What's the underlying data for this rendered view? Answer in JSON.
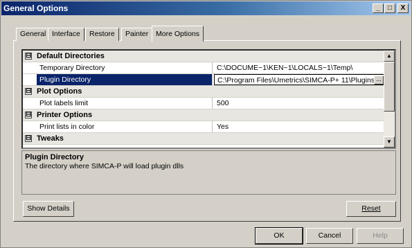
{
  "window": {
    "title": "General Options",
    "controls": {
      "minimize": "_",
      "maximize": "□",
      "close": "X"
    }
  },
  "tabs": [
    {
      "label": "General",
      "active": false
    },
    {
      "label": "Interface",
      "active": false
    },
    {
      "label": "Restore",
      "active": false
    },
    {
      "label": "Painter",
      "active": false
    },
    {
      "label": "More Options",
      "active": true
    }
  ],
  "grid": {
    "rows": [
      {
        "kind": "category",
        "label": "Default Directories",
        "expander": "⊟"
      },
      {
        "kind": "property",
        "name": "Temporary Directory",
        "value": "C:\\DOCUME~1\\KEN~1\\LOCALS~1\\Temp\\",
        "selected": false
      },
      {
        "kind": "property",
        "name": "Plugin Directory",
        "value": "C:\\Program Files\\Umetrics\\SIMCA-P+ 11\\Plugins",
        "selected": true,
        "ellipsis": "..."
      },
      {
        "kind": "category",
        "label": "Plot Options",
        "expander": "⊟"
      },
      {
        "kind": "property",
        "name": "Plot labels limit",
        "value": "500",
        "selected": false
      },
      {
        "kind": "category",
        "label": "Printer Options",
        "expander": "⊟"
      },
      {
        "kind": "property",
        "name": "Print lists in color",
        "value": "Yes",
        "selected": false
      },
      {
        "kind": "category",
        "label": "Tweaks",
        "expander": "⊟"
      }
    ],
    "scroll_up": "▲",
    "scroll_down": "▼"
  },
  "description": {
    "title": "Plugin Directory",
    "text": "The directory where SIMCA-P will load plugin dlls"
  },
  "buttons": {
    "show_details": "Show Details",
    "reset": "Reset",
    "ok": "OK",
    "cancel": "Cancel",
    "help": "Help"
  },
  "colors": {
    "titlebar_start": "#0a246a",
    "titlebar_end": "#a6caf0",
    "selection": "#0a246a",
    "dialog_face": "#d4d0c8"
  }
}
